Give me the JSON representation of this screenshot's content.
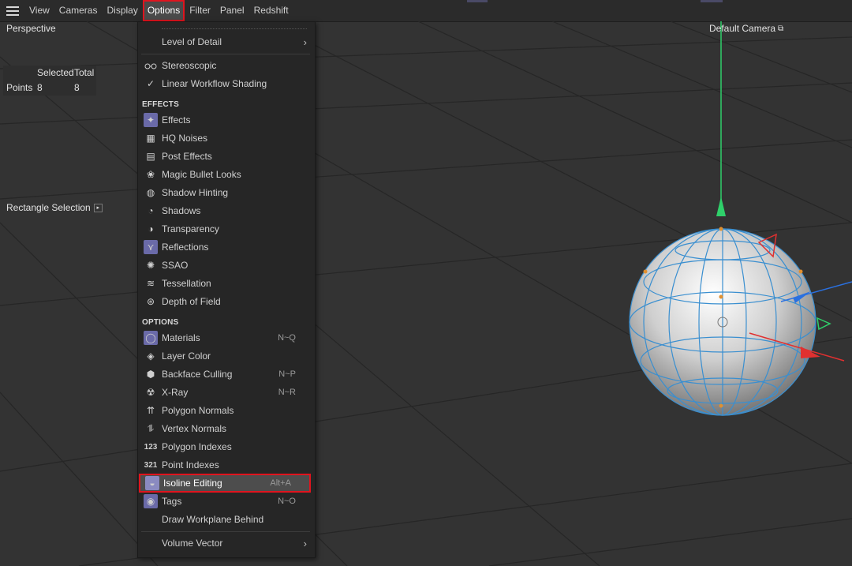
{
  "menubar": {
    "items": [
      {
        "label": "View"
      },
      {
        "label": "Cameras"
      },
      {
        "label": "Display"
      },
      {
        "label": "Options"
      },
      {
        "label": "Filter"
      },
      {
        "label": "Panel"
      },
      {
        "label": "Redshift"
      }
    ]
  },
  "viewport": {
    "label": "Perspective",
    "camera": "Default Camera",
    "camera_icon": "lock-camera-icon",
    "tool": "Rectangle Selection",
    "stats": {
      "header_selected": "Selected",
      "header_total": "Total",
      "row_label": "Points",
      "selected": "8",
      "total": "8"
    }
  },
  "options_menu": {
    "level_of_detail": "Level of Detail",
    "stereoscopic": "Stereoscopic",
    "linear_workflow": "Linear Workflow Shading",
    "effects_header": "EFFECTS",
    "effects": [
      {
        "label": "Effects",
        "icon": "effects-icon"
      },
      {
        "label": "HQ Noises",
        "icon": "noise-icon"
      },
      {
        "label": "Post Effects",
        "icon": "clapper-icon"
      },
      {
        "label": "Magic Bullet Looks",
        "icon": "bullet-icon"
      },
      {
        "label": "Shadow Hinting",
        "icon": "shadow-hint-icon"
      },
      {
        "label": "Shadows",
        "icon": "shadow-icon"
      },
      {
        "label": "Transparency",
        "icon": "half-circle-icon"
      },
      {
        "label": "Reflections",
        "icon": "reflection-icon"
      },
      {
        "label": "SSAO",
        "icon": "ssao-icon"
      },
      {
        "label": "Tessellation",
        "icon": "waves-icon"
      },
      {
        "label": "Depth of Field",
        "icon": "aperture-icon"
      }
    ],
    "options_header": "OPTIONS",
    "options": [
      {
        "label": "Materials",
        "shortcut": "N~Q",
        "icon": "sphere-icon"
      },
      {
        "label": "Layer Color",
        "shortcut": "",
        "icon": "layers-icon"
      },
      {
        "label": "Backface Culling",
        "shortcut": "N~P",
        "icon": "cube-icon"
      },
      {
        "label": "X-Ray",
        "shortcut": "N~R",
        "icon": "xray-icon"
      },
      {
        "label": "Polygon Normals",
        "shortcut": "",
        "icon": "normals-icon"
      },
      {
        "label": "Vertex Normals",
        "shortcut": "",
        "icon": "vertex-normals-icon"
      },
      {
        "label": "Polygon Indexes",
        "shortcut": "",
        "icon": "index-123-icon"
      },
      {
        "label": "Point Indexes",
        "shortcut": "",
        "icon": "index-321-icon"
      },
      {
        "label": "Isoline Editing",
        "shortcut": "Alt+A",
        "icon": "isoline-icon"
      },
      {
        "label": "Tags",
        "shortcut": "N~O",
        "icon": "eye-icon"
      },
      {
        "label": "Draw Workplane Behind",
        "shortcut": "",
        "icon": ""
      }
    ],
    "volume_vector": "Volume Vector"
  }
}
